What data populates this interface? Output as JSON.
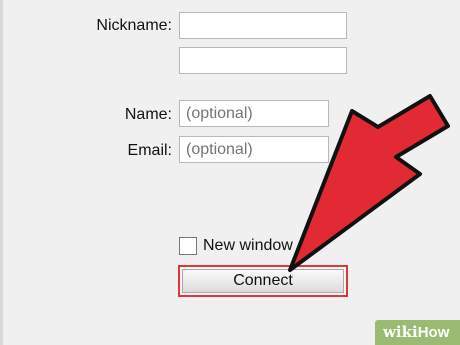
{
  "form": {
    "nickname_label": "Nickname:",
    "name_label": "Name:",
    "email_label": "Email:",
    "name_placeholder": "(optional)",
    "email_placeholder": "(optional)",
    "new_window_label": "New window",
    "connect_label": "Connect"
  },
  "watermark": {
    "wiki": "wiki",
    "how": "How"
  },
  "colors": {
    "arrow": "#e22a35",
    "highlight": "#d63a3a",
    "badge": "#9bbb73"
  },
  "icons": {
    "pointer": "red-arrow-icon"
  }
}
